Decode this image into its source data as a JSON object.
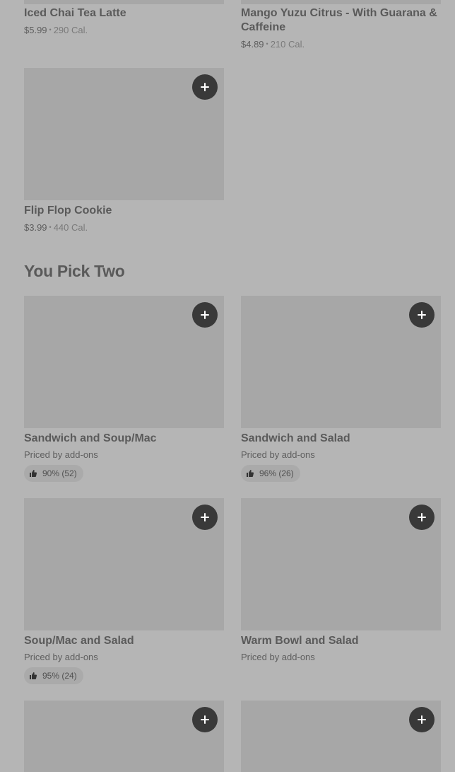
{
  "top_items": [
    {
      "title": "Iced Chai Tea Latte",
      "price": "$5.99",
      "calories": "290 Cal."
    },
    {
      "title": "Mango Yuzu Citrus - With Guarana & Caffeine",
      "price": "$4.89",
      "calories": "210 Cal."
    },
    {
      "title": "Flip Flop Cookie",
      "price": "$3.99",
      "calories": "440 Cal."
    }
  ],
  "section": {
    "title": "You Pick Two"
  },
  "pick_two_items": [
    {
      "title": "Sandwich and Soup/Mac",
      "price_note": "Priced by add-ons",
      "rating": "90% (52)"
    },
    {
      "title": "Sandwich and Salad",
      "price_note": "Priced by add-ons",
      "rating": "96% (26)"
    },
    {
      "title": "Soup/Mac and Salad",
      "price_note": "Priced by add-ons",
      "rating": "95% (24)"
    },
    {
      "title": "Warm Bowl and Salad",
      "price_note": "Priced by add-ons"
    }
  ],
  "separator": "•",
  "icons": {
    "add": "plus-icon",
    "rating": "thumbs-up-icon"
  },
  "colors": {
    "background": "#b5b5b5",
    "image_placeholder": "#a7a7a7",
    "add_button": "#393939"
  }
}
